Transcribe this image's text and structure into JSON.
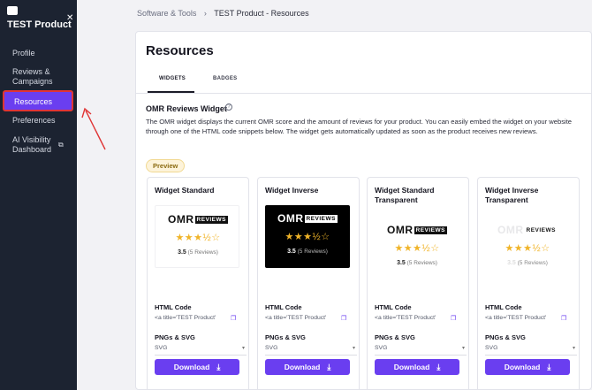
{
  "sidebar": {
    "title": "TEST Product",
    "items": [
      {
        "label": "Profile"
      },
      {
        "label": "Reviews & Campaigns"
      },
      {
        "label": "Resources"
      },
      {
        "label": "Preferences"
      },
      {
        "label": "AI Visibility Dashboard"
      }
    ]
  },
  "breadcrumb": {
    "parent": "Software & Tools",
    "separator": "›",
    "current": "TEST Product - Resources"
  },
  "page": {
    "title": "Resources"
  },
  "tabs": [
    {
      "label": "WIDGETS"
    },
    {
      "label": "BADGES"
    }
  ],
  "section": {
    "title": "OMR Reviews Widget",
    "info_icon": "?",
    "description": "The OMR widget displays the current OMR score and the amount of reviews for your product. You can easily embed the widget on your website through one of the HTML code snippets below. The widget gets automatically updated as soon as the product receives new reviews.",
    "preview_label": "Preview"
  },
  "widgets": [
    {
      "name": "Widget Standard",
      "logo_text": "OMR",
      "logo_badge": "REVIEWS",
      "stars": "★★★½☆",
      "score": "3.5",
      "reviews": "(5 Reviews)",
      "html_code_label": "HTML Code",
      "html_code": "<a title='TEST Product'",
      "png_label": "PNGs & SVG",
      "format": "SVG",
      "download_label": "Download"
    },
    {
      "name": "Widget Inverse",
      "logo_text": "OMR",
      "logo_badge": "REVIEWS",
      "stars": "★★★½☆",
      "score": "3.5",
      "reviews": "(5 Reviews)",
      "html_code_label": "HTML Code",
      "html_code": "<a title='TEST Product'",
      "png_label": "PNGs & SVG",
      "format": "SVG",
      "download_label": "Download"
    },
    {
      "name": "Widget Standard Transparent",
      "logo_text": "OMR",
      "logo_badge": "REVIEWS",
      "stars": "★★★½☆",
      "score": "3.5",
      "reviews": "(5 Reviews)",
      "html_code_label": "HTML Code",
      "html_code": "<a title='TEST Product'",
      "png_label": "PNGs & SVG",
      "format": "SVG",
      "download_label": "Download"
    },
    {
      "name": "Widget Inverse Transparent",
      "logo_text": "OMR",
      "logo_badge": "REVIEWS",
      "stars": "★★★½☆",
      "score": "3.5",
      "reviews": "(5 Reviews)",
      "html_code_label": "HTML Code",
      "html_code": "<a title='TEST Product'",
      "png_label": "PNGs & SVG",
      "format": "SVG",
      "download_label": "Download"
    }
  ],
  "colors": {
    "accent": "#6a3ef0",
    "sidebar_bg": "#1c2331",
    "annotation": "#e03535",
    "star": "#f0b429"
  }
}
